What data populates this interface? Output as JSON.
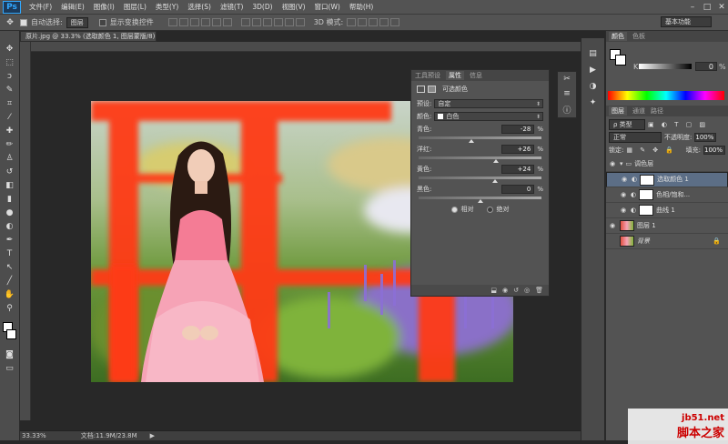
{
  "app": {
    "logo": "Ps"
  },
  "menu": [
    "文件(F)",
    "编辑(E)",
    "图像(I)",
    "图层(L)",
    "类型(Y)",
    "选择(S)",
    "滤镜(T)",
    "3D(D)",
    "视图(V)",
    "窗口(W)",
    "帮助(H)"
  ],
  "options": {
    "auto_select_label": "自动选择:",
    "auto_select_value": "图层",
    "show_transform_label": "显示变换控件",
    "mode_3d_label": "3D 模式:",
    "workspace": "基本功能"
  },
  "document": {
    "tab_title": "原片.jpg @ 33.3% (选取颜色 1, 图层蒙版/8) *",
    "zoom": "33.33%",
    "doc_size": "文档:11.9M/23.8M"
  },
  "properties": {
    "tabs": [
      "工具预设",
      "属性",
      "信息"
    ],
    "active_tab": "属性",
    "title": "可选颜色",
    "preset_label": "预设:",
    "preset_value": "自定",
    "colors_label": "颜色:",
    "colors_value": "白色",
    "sliders": [
      {
        "label": "青色:",
        "value": "-28",
        "unit": "%",
        "knob": 0.43
      },
      {
        "label": "洋红:",
        "value": "+26",
        "unit": "%",
        "knob": 0.63
      },
      {
        "label": "黄色:",
        "value": "+24",
        "unit": "%",
        "knob": 0.62
      },
      {
        "label": "黑色:",
        "value": "0",
        "unit": "%",
        "knob": 0.5
      }
    ],
    "mode_relative": "相对",
    "mode_absolute": "绝对"
  },
  "color_panel": {
    "tabs": [
      "颜色",
      "色板"
    ],
    "k_label": "K",
    "k_value": "0",
    "k_unit": "%"
  },
  "layers_panel": {
    "tabs": [
      "图层",
      "通道",
      "路径"
    ],
    "filter_kind": "ρ 类型",
    "blend_mode": "正常",
    "opacity_label": "不透明度:",
    "opacity_value": "100%",
    "lock_label": "锁定:",
    "fill_label": "填充:",
    "fill_value": "100%",
    "layers": [
      {
        "name": "调色层",
        "kind": "group"
      },
      {
        "name": "选取颜色 1",
        "kind": "adjust",
        "selected": true
      },
      {
        "name": "色相/饱和...",
        "kind": "adjust"
      },
      {
        "name": "曲线 1",
        "kind": "adjust"
      },
      {
        "name": "图层 1",
        "kind": "pixel"
      },
      {
        "name": "背景",
        "kind": "background"
      }
    ]
  },
  "watermark": {
    "line1": "jb51.net",
    "line2": "脚本之家"
  },
  "colors": {
    "accent": "#31a8ff",
    "panel": "#535353",
    "bg": "#282828",
    "selected_layer": "#5c6e86"
  }
}
